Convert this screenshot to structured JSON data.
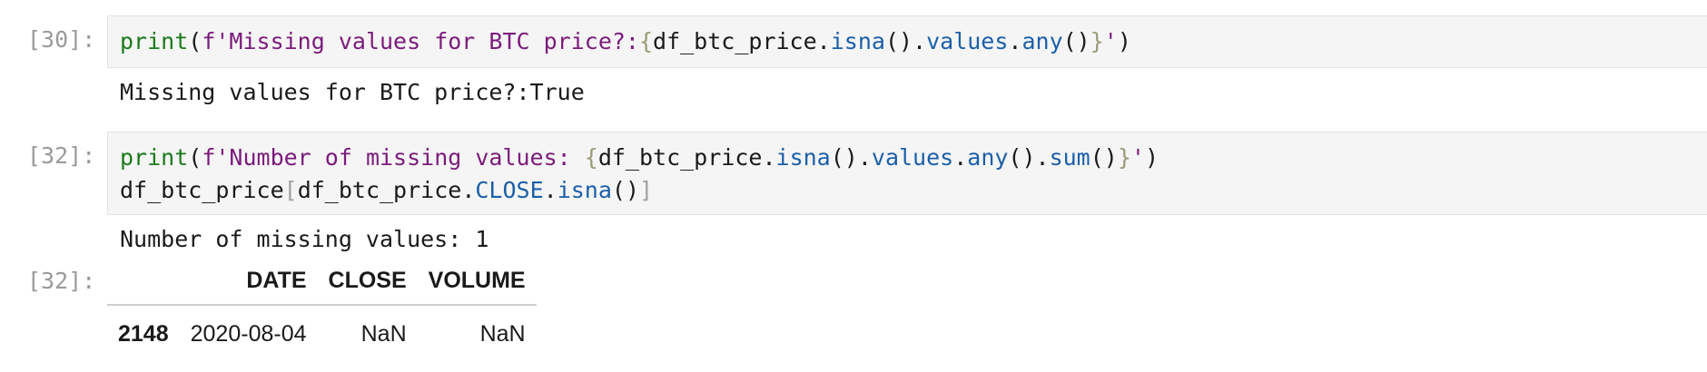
{
  "cells": [
    {
      "prompt": "[30]:",
      "code_lines": [
        [
          {
            "t": "print",
            "k": "fn"
          },
          {
            "t": "(",
            "k": "plain"
          },
          {
            "t": "f'Missing values for BTC price?:",
            "k": "str"
          },
          {
            "t": "{",
            "k": "brace"
          },
          {
            "t": "df_btc_price",
            "k": "plain"
          },
          {
            "t": ".",
            "k": "plain"
          },
          {
            "t": "isna",
            "k": "attr"
          },
          {
            "t": "().",
            "k": "plain"
          },
          {
            "t": "values",
            "k": "attr"
          },
          {
            "t": ".",
            "k": "plain"
          },
          {
            "t": "any",
            "k": "attr"
          },
          {
            "t": "()",
            "k": "plain"
          },
          {
            "t": "}",
            "k": "brace"
          },
          {
            "t": "'",
            "k": "str"
          },
          {
            "t": ")",
            "k": "plain"
          }
        ]
      ],
      "output": "Missing values for BTC price?:True"
    },
    {
      "prompt": "[32]:",
      "code_lines": [
        [
          {
            "t": "print",
            "k": "fn"
          },
          {
            "t": "(",
            "k": "plain"
          },
          {
            "t": "f'Number of missing values: ",
            "k": "str"
          },
          {
            "t": "{",
            "k": "brace"
          },
          {
            "t": "df_btc_price",
            "k": "plain"
          },
          {
            "t": ".",
            "k": "plain"
          },
          {
            "t": "isna",
            "k": "attr"
          },
          {
            "t": "().",
            "k": "plain"
          },
          {
            "t": "values",
            "k": "attr"
          },
          {
            "t": ".",
            "k": "plain"
          },
          {
            "t": "any",
            "k": "attr"
          },
          {
            "t": "().",
            "k": "plain"
          },
          {
            "t": "sum",
            "k": "attr"
          },
          {
            "t": "()",
            "k": "plain"
          },
          {
            "t": "}",
            "k": "brace"
          },
          {
            "t": "'",
            "k": "str"
          },
          {
            "t": ")",
            "k": "plain"
          }
        ],
        [
          {
            "t": "df_btc_price",
            "k": "plain"
          },
          {
            "t": "[",
            "k": "bracket"
          },
          {
            "t": "df_btc_price",
            "k": "plain"
          },
          {
            "t": ".",
            "k": "plain"
          },
          {
            "t": "CLOSE",
            "k": "attr"
          },
          {
            "t": ".",
            "k": "plain"
          },
          {
            "t": "isna",
            "k": "attr"
          },
          {
            "t": "()",
            "k": "plain"
          },
          {
            "t": "]",
            "k": "bracket"
          }
        ]
      ],
      "output": "Number of missing values: 1",
      "result_prompt": "[32]:"
    }
  ],
  "dataframe": {
    "columns": [
      "",
      "DATE",
      "CLOSE",
      "VOLUME"
    ],
    "rows": [
      [
        "2148",
        "2020-08-04",
        "NaN",
        "NaN"
      ]
    ]
  }
}
